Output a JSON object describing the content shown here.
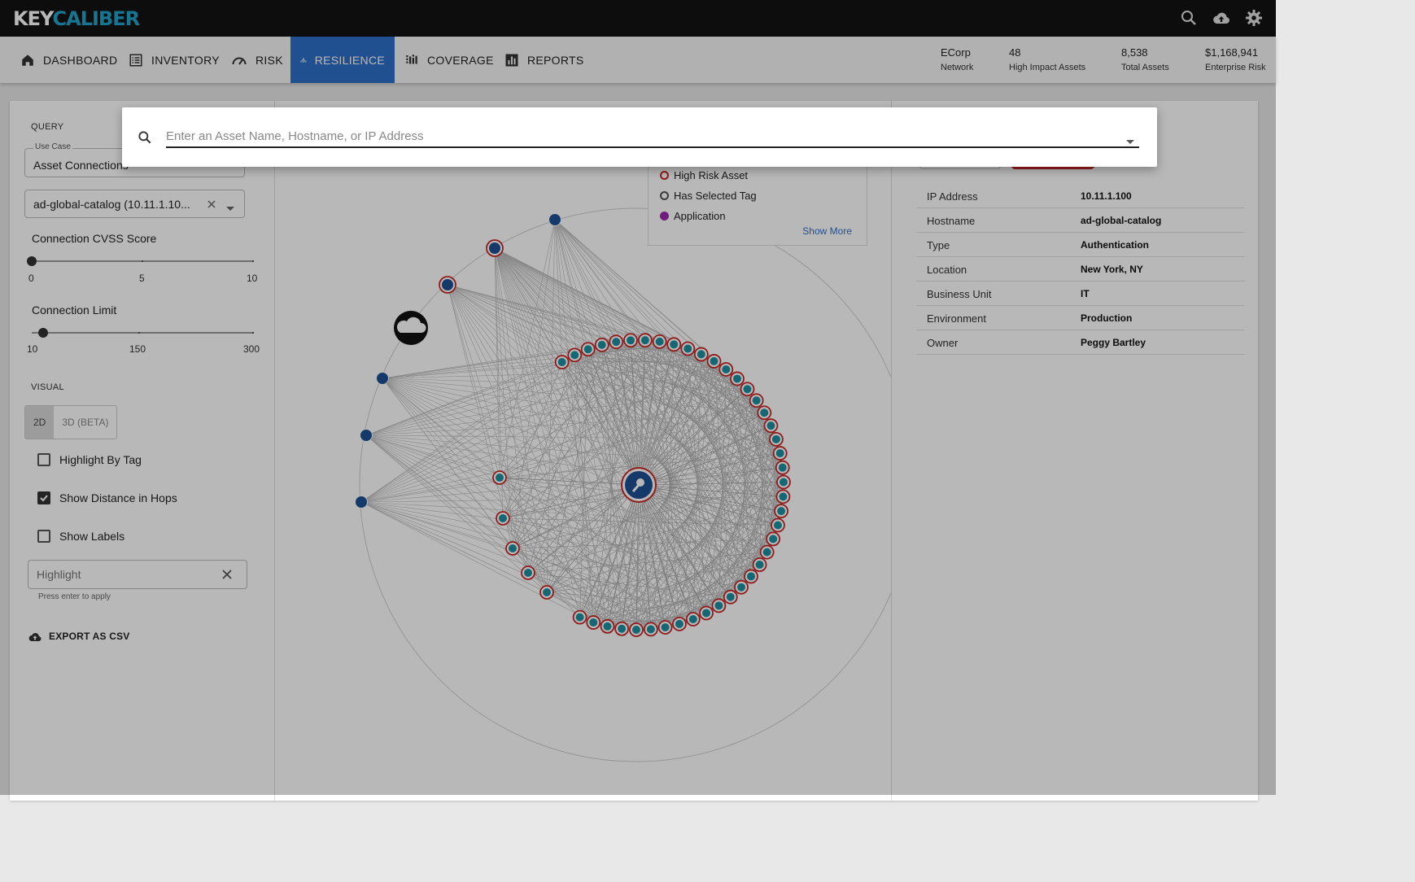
{
  "brand": {
    "logo_part1": "KEY",
    "logo_part2": "CALIBER",
    "accent": "#1fa3c8"
  },
  "topbar": {
    "icons": [
      "search-icon",
      "cloud-upload-icon",
      "gear-icon"
    ]
  },
  "nav": {
    "items": [
      {
        "label": "DASHBOARD",
        "icon": "home-icon"
      },
      {
        "label": "INVENTORY",
        "icon": "list-icon"
      },
      {
        "label": "RISK",
        "icon": "gauge-icon"
      },
      {
        "label": "RESILIENCE",
        "icon": "network-icon",
        "active": true
      },
      {
        "label": "COVERAGE",
        "icon": "coverage-icon"
      },
      {
        "label": "REPORTS",
        "icon": "bar-chart-icon"
      }
    ],
    "active_color": "#2f6fc8"
  },
  "stats": [
    {
      "value": "ECorp",
      "label": "Network"
    },
    {
      "value": "48",
      "label": "High Impact Assets"
    },
    {
      "value": "8,538",
      "label": "Total Assets"
    },
    {
      "value": "$1,168,941",
      "label": "Enterprise Risk"
    }
  ],
  "query": {
    "section_label": "QUERY",
    "use_case_label": "Use Case",
    "use_case_value": "Asset Connections",
    "asset_value": "ad-global-catalog (10.11.1.10...",
    "cvss": {
      "label": "Connection CVSS Score",
      "min": "0",
      "mid": "5",
      "max": "10",
      "value": 0
    },
    "limit": {
      "label": "Connection Limit",
      "min": "10",
      "mid": "150",
      "max": "300",
      "value": 25
    }
  },
  "visual": {
    "section_label": "VISUAL",
    "toggle_2d": "2D",
    "toggle_3d": "3D (BETA)",
    "highlight_by_tag": "Highlight By Tag",
    "show_distance": "Show Distance in Hops",
    "show_labels": "Show Labels",
    "highlight_placeholder": "Highlight",
    "helper": "Press enter to apply",
    "export_label": "EXPORT AS CSV"
  },
  "legend": {
    "items": [
      {
        "label": "High Risk Asset",
        "color": "#c62828",
        "style": "ring"
      },
      {
        "label": "Has Selected Tag",
        "color": "#555555",
        "style": "ring"
      },
      {
        "label": "Application",
        "color": "#9c27b0",
        "style": "fill"
      }
    ],
    "show_more": "Show More"
  },
  "details": [
    {
      "key": "IP Address",
      "value": "10.11.1.100"
    },
    {
      "key": "Hostname",
      "value": "ad-global-catalog"
    },
    {
      "key": "Type",
      "value": "Authentication"
    },
    {
      "key": "Location",
      "value": "New York, NY"
    },
    {
      "key": "Business Unit",
      "value": "IT"
    },
    {
      "key": "Environment",
      "value": "Production"
    },
    {
      "key": "Owner",
      "value": "Peggy Bartley"
    }
  ],
  "search": {
    "placeholder": "Enter an Asset Name, Hostname, or IP Address",
    "value": ""
  },
  "graph": {
    "center_asset": "ad-global-catalog",
    "node_fill": "#1e4f91",
    "ring_color": "#c62828",
    "ring_node_count": 42,
    "outer_node_count": 7
  }
}
